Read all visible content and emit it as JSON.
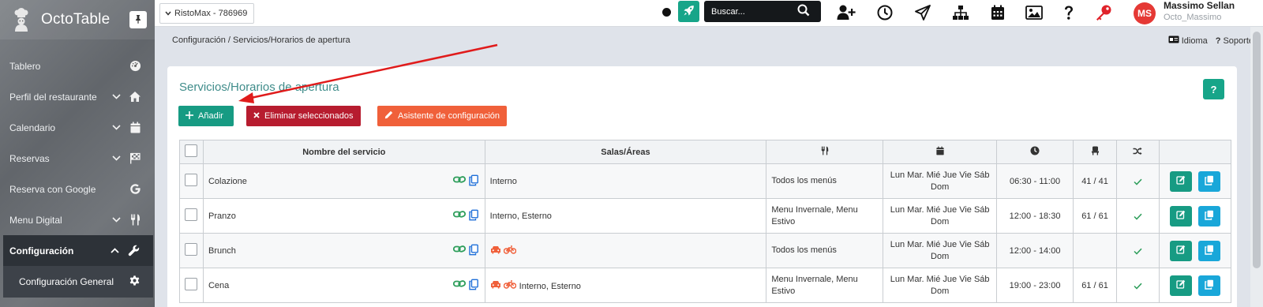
{
  "app": {
    "name": "OctoTable"
  },
  "sidebar": {
    "items": [
      {
        "label": "Tablero",
        "icon": "dashboard-icon",
        "has_chevron": false
      },
      {
        "label": "Perfil del restaurante",
        "icon": "home-icon",
        "has_chevron": true
      },
      {
        "label": "Calendario",
        "icon": "calendar-icon",
        "has_chevron": true
      },
      {
        "label": "Reservas",
        "icon": "flag-icon",
        "has_chevron": true
      },
      {
        "label": "Reserva con Google",
        "icon": "google-icon",
        "has_chevron": false
      },
      {
        "label": "Menu Digital",
        "icon": "utensils-icon",
        "has_chevron": true
      },
      {
        "label": "Configuración",
        "icon": "wrench-icon",
        "has_chevron": true,
        "active": true
      }
    ],
    "sub_item": {
      "label": "Configuración General",
      "icon": "gear-icon"
    }
  },
  "topbar": {
    "venue": "RistoMax - 786969",
    "search_placeholder": "Buscar...",
    "avatar_initials": "MS",
    "user_name": "Massimo Sellan",
    "user_handle": "Octo_Massimo"
  },
  "breadcrumb": "Configuración / Servicios/Horarios de apertura",
  "toplinks": {
    "language": "Idioma",
    "support": "Soporte"
  },
  "page": {
    "title": "Servicios/Horarios de apertura",
    "help": "?",
    "buttons": {
      "add": "Añadir",
      "delete": "Eliminar seleccionados",
      "wizard": "Asistente de configuración"
    }
  },
  "table": {
    "headers": {
      "name": "Nombre del servicio",
      "rooms": "Salas/Áreas"
    },
    "rows": [
      {
        "name": "Colazione",
        "rooms": "Interno",
        "room_icons": false,
        "menus": "Todos los menús",
        "days_1": "Lun Mar. Mié Jue Vie Sáb",
        "days_2": "Dom",
        "time": "06:30 - 11:00",
        "capacity": "41 / 41"
      },
      {
        "name": "Pranzo",
        "rooms": "Interno, Esterno",
        "room_icons": false,
        "menus": "Menu Invernale, Menu Estivo",
        "days_1": "Lun Mar. Mié Jue Vie Sáb",
        "days_2": "Dom",
        "time": "12:00 - 18:30",
        "capacity": "61 / 61"
      },
      {
        "name": "Brunch",
        "rooms": "",
        "room_icons": true,
        "menus": "Todos los menús",
        "days_1": "Lun Mar. Mié Jue Vie Sáb",
        "days_2": "Dom",
        "time": "12:00 - 14:00",
        "capacity": ""
      },
      {
        "name": "Cena",
        "rooms": "Interno, Esterno",
        "room_icons": true,
        "menus": "Menu Invernale, Menu Estivo",
        "days_1": "Lun Mar. Mié Jue Vie Sáb",
        "days_2": "Dom",
        "time": "19:00 - 23:00",
        "capacity": "61 / 61"
      }
    ]
  },
  "colors": {
    "accent": "#179b83",
    "danger": "#b71c2f",
    "warning": "#f0603a",
    "info": "#19a7d9",
    "annotation_arrow": "#e01b1b"
  }
}
